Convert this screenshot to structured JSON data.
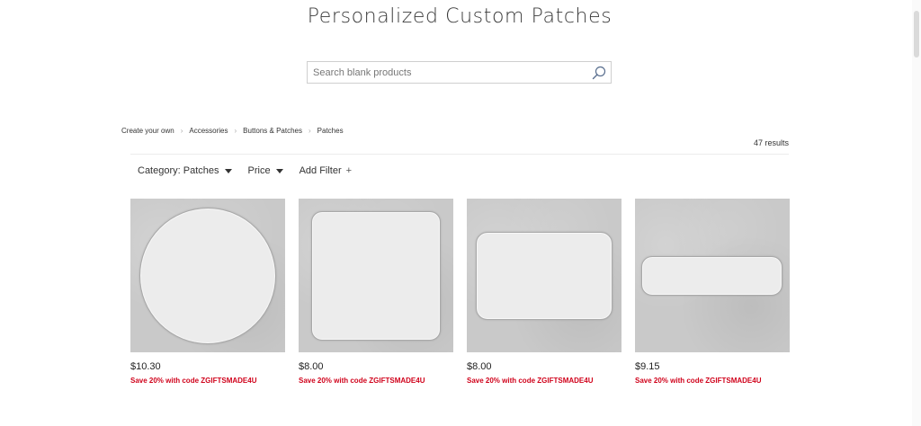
{
  "page_title": "Personalized Custom Patches",
  "search": {
    "placeholder": "Search blank products",
    "icon": "search-icon"
  },
  "breadcrumb": [
    "Create your own",
    "Accessories",
    "Buttons & Patches",
    "Patches"
  ],
  "results_label": "47 results",
  "filters": {
    "category": "Category: Patches",
    "price": "Price",
    "add_filter": "Add Filter",
    "add_icon": "+"
  },
  "products": [
    {
      "shape": "circle",
      "price": "$10.30",
      "promo": "Save 20% with code ZGIFTSMADE4U"
    },
    {
      "shape": "square",
      "price": "$8.00",
      "promo": "Save 20% with code ZGIFTSMADE4U"
    },
    {
      "shape": "rect",
      "price": "$8.00",
      "promo": "Save 20% with code ZGIFTSMADE4U"
    },
    {
      "shape": "bar",
      "price": "$9.15",
      "promo": "Save 20% with code ZGIFTSMADE4U"
    }
  ],
  "colors": {
    "promo": "#d0021b",
    "text": "#333333",
    "thumb_bg": "#c9c9c9"
  }
}
